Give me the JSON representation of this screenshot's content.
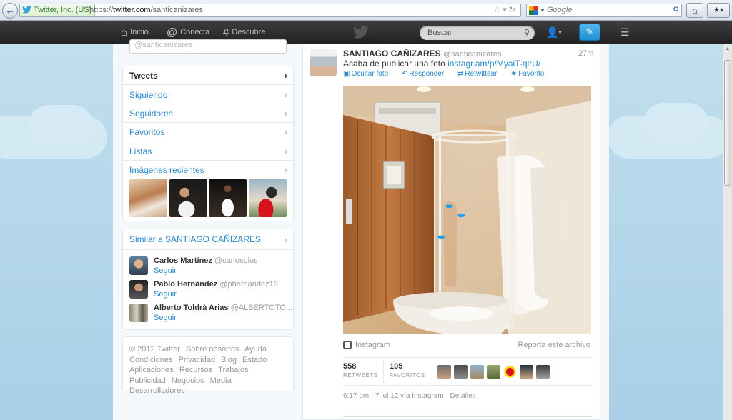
{
  "browser": {
    "site_identity": "Twitter, Inc. (US)",
    "url_prefix": "https://",
    "url_domain": "twitter.com",
    "url_path": "/santicanizares",
    "search_placeholder": "Google"
  },
  "topbar": {
    "nav": [
      {
        "label": "Inicio",
        "icon": "home-icon"
      },
      {
        "label": "Conecta",
        "icon": "at-icon"
      },
      {
        "label": "Descubre",
        "icon": "hash-icon"
      }
    ],
    "search_placeholder": "Buscar"
  },
  "dashboard": {
    "follow_input": "@santicanizares",
    "nav_items": [
      {
        "label": "Tweets",
        "active": true
      },
      {
        "label": "Siguiendo",
        "active": false
      },
      {
        "label": "Seguidores",
        "active": false
      },
      {
        "label": "Favoritos",
        "active": false
      },
      {
        "label": "Listas",
        "active": false
      },
      {
        "label": "Imágenes recientes",
        "active": false
      }
    ]
  },
  "similar": {
    "title": "Similar a SANTIAGO CAÑIZARES",
    "users": [
      {
        "name": "Carlos Martínez",
        "handle": "@carlosplus",
        "follow": "Seguir"
      },
      {
        "name": "Pablo Hernández",
        "handle": "@phernandez19",
        "follow": "Seguir"
      },
      {
        "name": "Alberto Toldrà Arias",
        "handle": "@ALBERTOTO...",
        "follow": "Seguir"
      }
    ]
  },
  "footer": {
    "links": [
      "© 2012 Twitter",
      "Sobre nosotros",
      "Ayuda",
      "Condiciones",
      "Privacidad",
      "Blog",
      "Estado",
      "Aplicaciones",
      "Recursos",
      "Trabajos",
      "Publicidad",
      "Negocios",
      "Media",
      "Desarrolladores"
    ]
  },
  "tweet": {
    "name": "SANTIAGO CAÑIZARES",
    "handle": "@santicanizares",
    "time": "27m",
    "text": "Acaba de publicar una foto",
    "link": "instagr.am/p/MyaiT-qlrU/",
    "actions": {
      "hide_photo": "Ocultar foto",
      "reply": "Responder",
      "retweet": "Retwittear",
      "favorite": "Favorito"
    },
    "source": "Instagram",
    "report": "Reporta este archivo",
    "retweets": "558",
    "retweets_label": "RETWEETS",
    "favorites": "105",
    "favorites_label": "FAVORITOS",
    "meta_time": "6:17 pm - 7 jul 12 vía Instagram",
    "meta_details": "Detalles"
  },
  "colors": {
    "link": "#2a89c9",
    "topbar": "#2b2b2b",
    "background": "#c0deed"
  }
}
